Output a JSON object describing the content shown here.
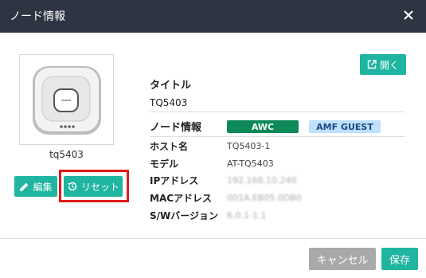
{
  "dialog": {
    "title": "ノード情報",
    "close_icon": "close-icon"
  },
  "device": {
    "name": "tq5403",
    "image_icon": "access-point-icon"
  },
  "buttons": {
    "edit_label": "編集",
    "reset_label": "リセット",
    "open_label": "開く",
    "cancel_label": "キャンセル",
    "save_label": "保存"
  },
  "info": {
    "title_label": "タイトル",
    "title_value": "TQ5403",
    "node_info_label": "ノード情報",
    "badges": [
      "AWC",
      "AMF GUEST"
    ],
    "rows": [
      {
        "label": "ホスト名",
        "value": "TQ5403-1"
      },
      {
        "label": "モデル",
        "value": "AT-TQ5403"
      },
      {
        "label": "IPアドレス",
        "value": "192.168.10.240"
      },
      {
        "label": "MACアドレス",
        "value": "001A.EB05.0DB0"
      },
      {
        "label": "S/Wバージョン",
        "value": "6.0.1-1.1"
      }
    ]
  },
  "colors": {
    "header_bg": "#2e3442",
    "accent": "#1fb5a0",
    "awc_badge": "#0e8a5a",
    "amf_badge": "#bfe0ff",
    "highlight_border": "#e01b1b",
    "cancel_bg": "#a9a9a9"
  }
}
